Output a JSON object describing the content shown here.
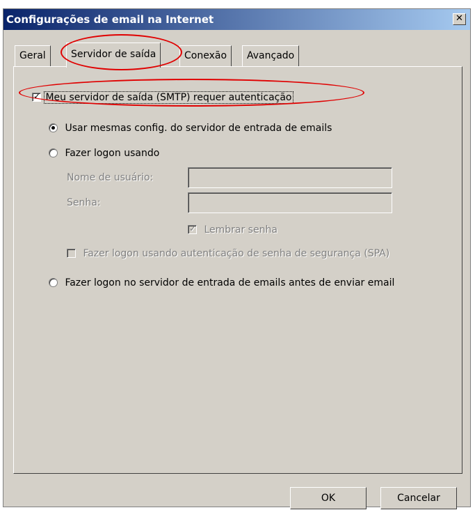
{
  "window": {
    "title": "Configurações de email na Internet",
    "close_glyph": "✕"
  },
  "tabs": [
    {
      "label": "Geral",
      "active": false
    },
    {
      "label": "Servidor de saída",
      "active": true
    },
    {
      "label": "Conexão",
      "active": false
    },
    {
      "label": "Avançado",
      "active": false
    }
  ],
  "smtp_auth": {
    "label": "Meu servidor de saída (SMTP) requer autenticação",
    "checked": true
  },
  "options": {
    "same_settings": {
      "label": "Usar mesmas config. do servidor de entrada de emails",
      "selected": true
    },
    "logon_using": {
      "label": "Fazer logon usando",
      "selected": false
    },
    "username_label": "Nome de usuário:",
    "username_value": "",
    "password_label": "Senha:",
    "password_value": "",
    "remember_password": {
      "label": "Lembrar senha",
      "checked": true,
      "enabled": false
    },
    "spa": {
      "label": "Fazer logon usando autenticação de senha de segurança (SPA)",
      "checked": false,
      "enabled": false
    },
    "logon_before_send": {
      "label": "Fazer logon no servidor de entrada de emails antes de enviar email",
      "selected": false
    }
  },
  "buttons": {
    "ok": "OK",
    "cancel": "Cancelar"
  },
  "annotation_color": "#e00000"
}
